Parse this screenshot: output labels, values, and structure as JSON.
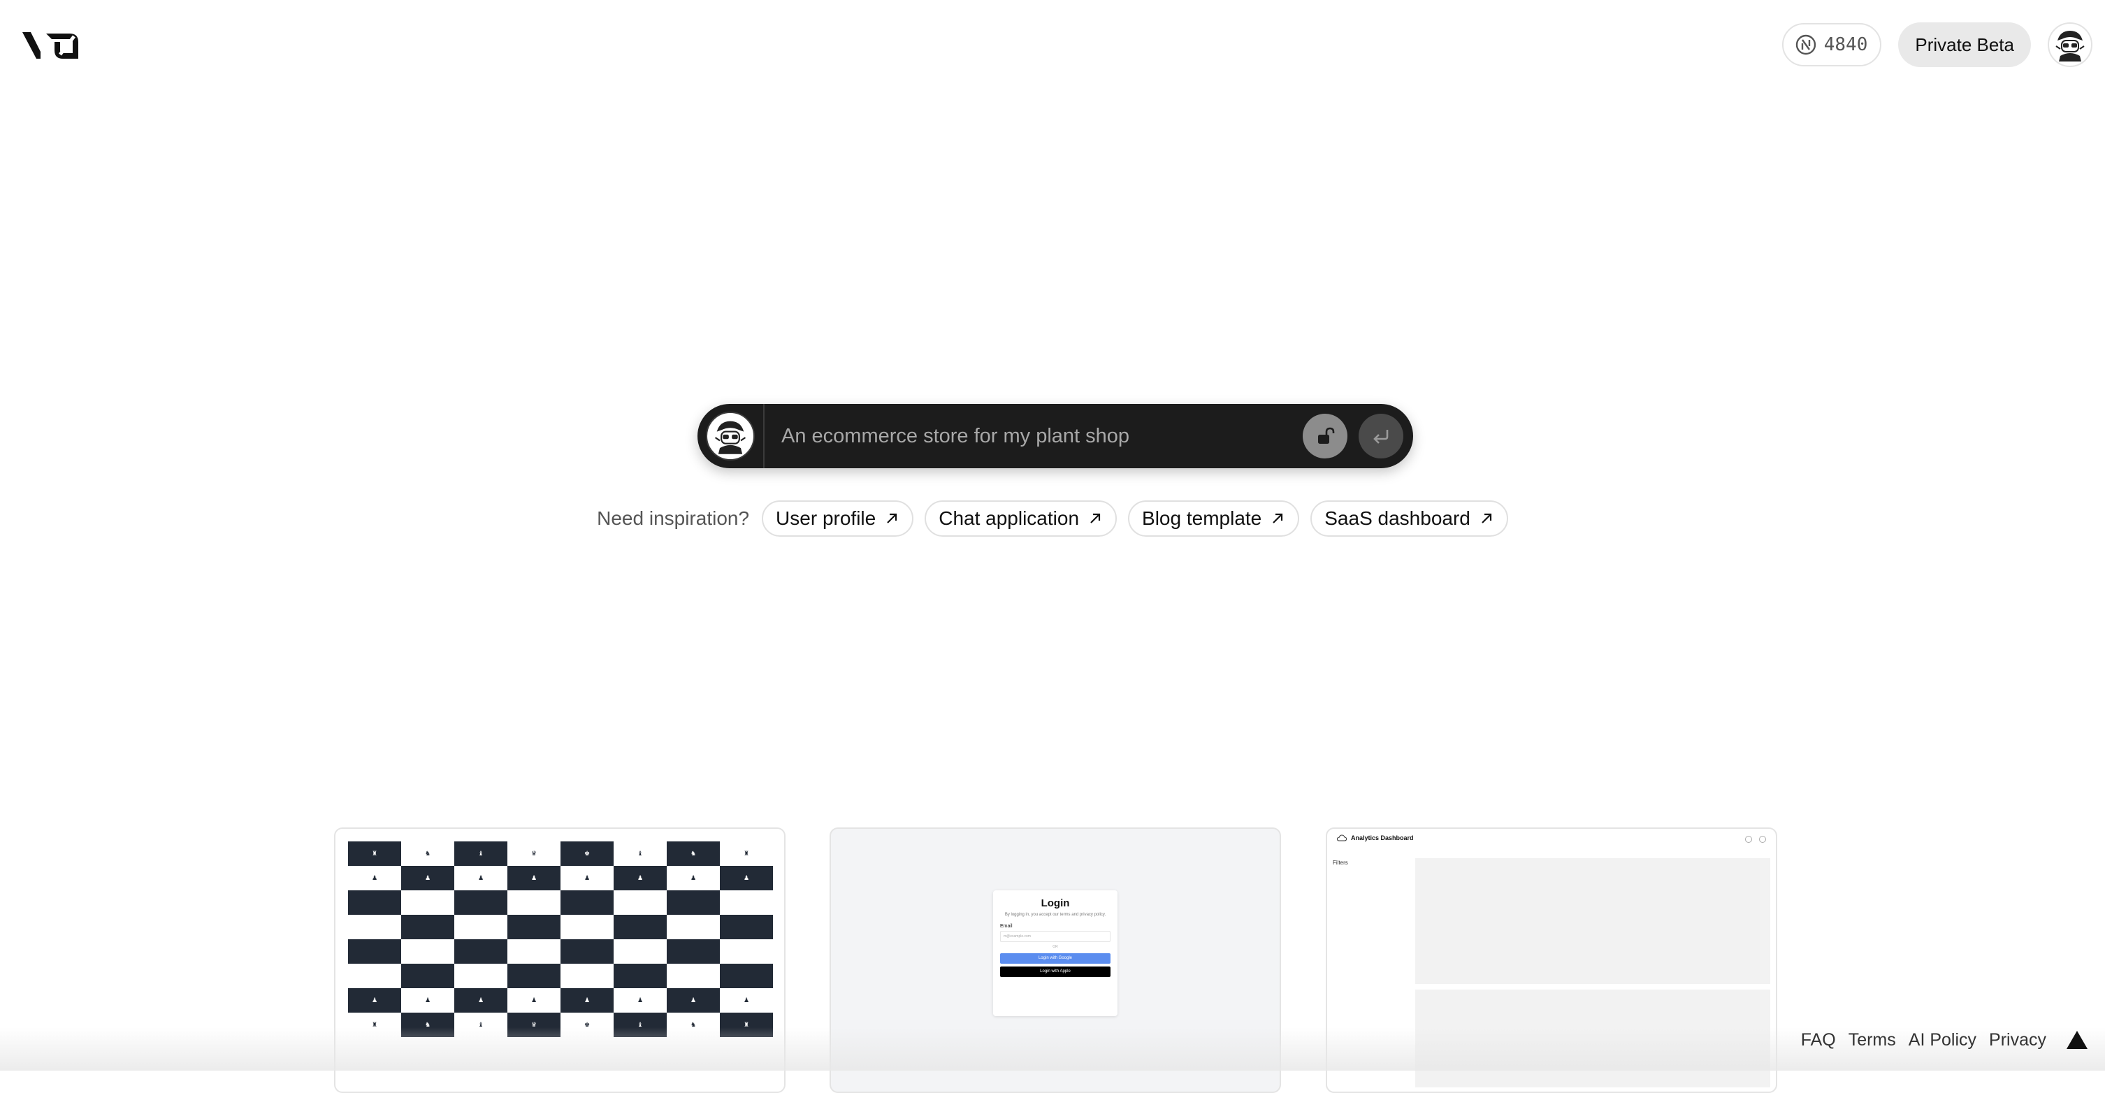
{
  "header": {
    "logo_name": "v0-logo",
    "credits": "4840",
    "beta_label": "Private Beta"
  },
  "prompt": {
    "placeholder": "An ecommerce store for my plant shop",
    "value": ""
  },
  "inspiration": {
    "label": "Need inspiration?",
    "chips": [
      {
        "label": "User profile"
      },
      {
        "label": "Chat application"
      },
      {
        "label": "Blog template"
      },
      {
        "label": "SaaS dashboard"
      }
    ]
  },
  "cards": {
    "login": {
      "title": "Login",
      "subtitle": "By logging in, you accept our terms and privacy policy.",
      "email_label": "Email",
      "email_placeholder": "m@example.com",
      "or_text": "OR",
      "google_button": "Login with Google",
      "apple_button": "Login with Apple"
    },
    "dashboard": {
      "title": "Analytics Dashboard",
      "filters_label": "Filters"
    }
  },
  "footer": {
    "links": [
      {
        "label": "FAQ"
      },
      {
        "label": "Terms"
      },
      {
        "label": "AI Policy"
      },
      {
        "label": "Privacy"
      }
    ]
  },
  "colors": {
    "prompt_bg": "#1c1c1c",
    "chip_border": "#e0e0e0",
    "beta_bg": "#e9e9e9",
    "chess_dark": "#222a36",
    "google_blue": "#5b8def"
  }
}
